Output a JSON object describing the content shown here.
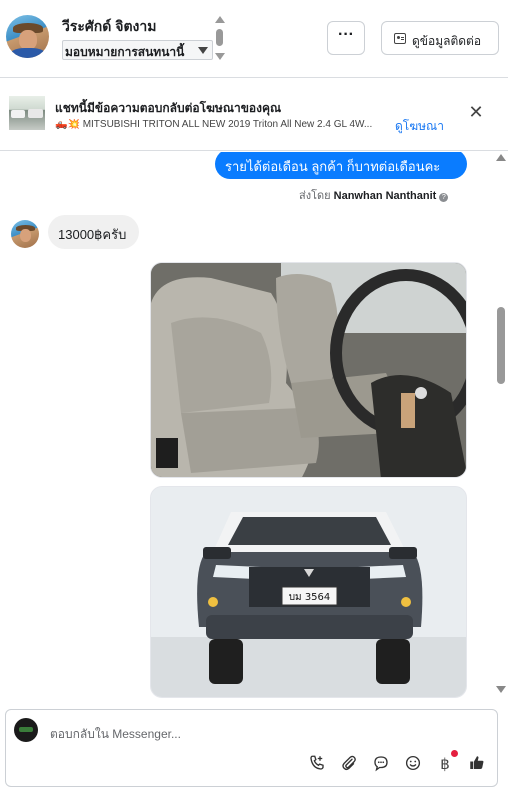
{
  "header": {
    "contact_name": "วีระศักด์ จิตงาม",
    "assign_label": "มอบหมายการสนทนานี้",
    "more_label": "···",
    "contact_info_label": "ดูข้อมูลติดต่อ"
  },
  "ad": {
    "title": "แชทนี้มีข้อความตอบกลับต่อโฆษณาของคุณ",
    "emoji": "🛻💥",
    "subtitle": "MITSUBISHI TRITON ALL NEW 2019 Triton All New 2.4 GL 4W...",
    "link_label": "ดูโฆษณา",
    "close_label": "✕"
  },
  "messages": {
    "outgoing_text": "รายได้ต่อเดือน  ลูกค้า ก็บาทต่อเดือนคะ",
    "sent_by_prefix": "ส่งโดย ",
    "sent_by_name": "Nanwhan Nanthanit",
    "incoming_text": "13000ฺฺฺฺฺฺฺฺฺฺฺฺฺฺฺฺฺฺฺฺฺฺฺฺฺฺฺฺฺฺฺฺฺฺฺฺฺฺฺฺฺฺฺฺฺฺฺฺฺฺฺฺฺฺฺฺฺฺฺฺฺฺฺฺฺฺฺฺฺฺฺฺฺฺฺฺฺฺฺฺฺฺฺฺฺฺฺฺ฿ครับ",
    "plate_text": "บม 3564"
  },
  "composer": {
    "placeholder": "ตอบกลับใน Messenger..."
  },
  "icons": [
    "phone-add-icon",
    "attach-icon",
    "chat-bubble-icon",
    "emoji-icon",
    "baht-icon",
    "thumbs-up-icon"
  ],
  "colors": {
    "accent": "#0a7cff",
    "link": "#1877f2",
    "notify": "#e41e3f"
  }
}
